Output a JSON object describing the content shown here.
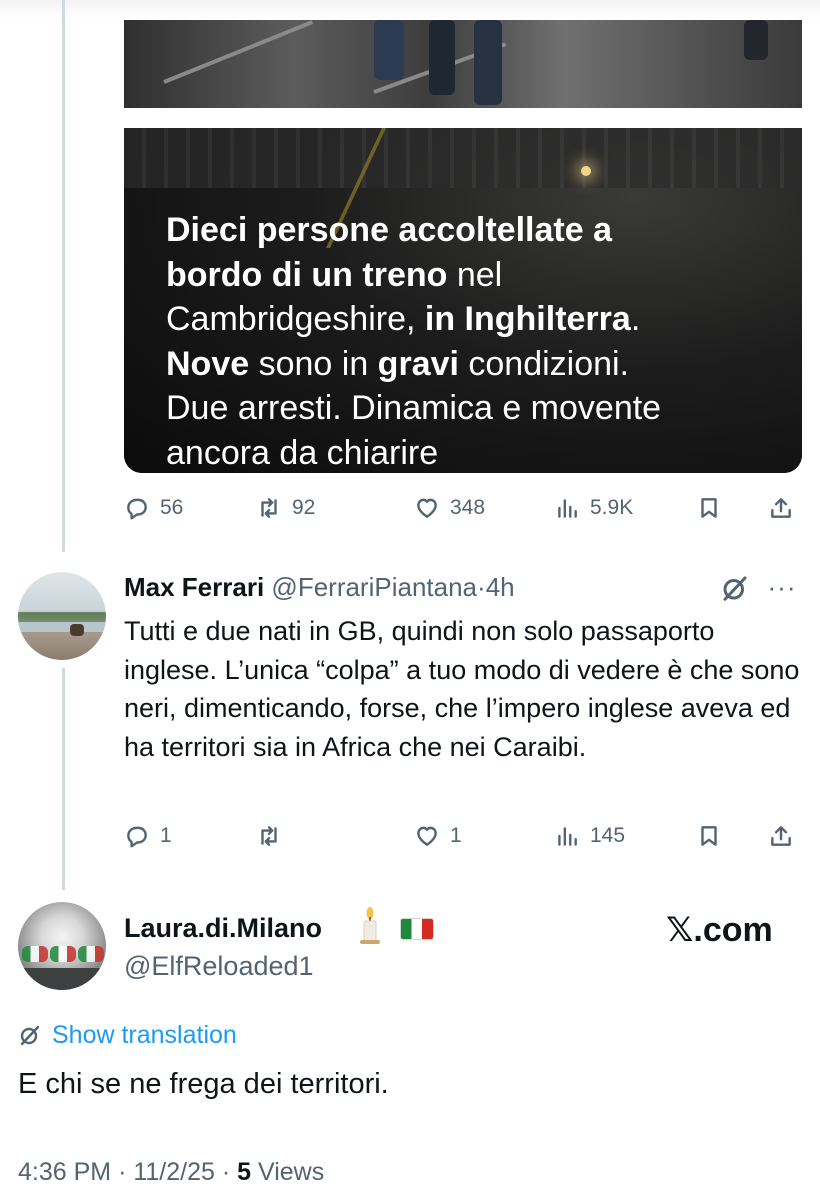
{
  "quoted_tweet": {
    "caption": {
      "line1_bold": "Dieci persone accoltellate a",
      "line2_bold": "bordo di un treno",
      "line2_rest": " nel",
      "line3_a": "Cambridgeshire, ",
      "line3_bold": "in Inghilterra",
      "line3_end": ".",
      "line4_bold_a": "Nove",
      "line4_mid": " sono in ",
      "line4_bold_b": "gravi",
      "line4_end": " condizioni.",
      "line5": "Due arresti. Dinamica e movente",
      "line6": "ancora da chiarire"
    },
    "stats": {
      "replies": "56",
      "reposts": "92",
      "likes": "348",
      "views": "5.9K"
    }
  },
  "reply": {
    "name": "Max Ferrari",
    "handle": "@FerrariPiantana",
    "separator": "·",
    "time": "4h",
    "more_label": "···",
    "text": "Tutti e due nati in GB, quindi non solo passaporto inglese. L’unica “colpa” a tuo modo di vedere è che sono neri, dimenticando, forse, che l’impero inglese aveva ed ha territori sia in Africa che nei Caraibi.",
    "stats": {
      "replies": "1",
      "reposts": "",
      "likes": "1",
      "views": "145"
    }
  },
  "main_tweet": {
    "name": "Laura.di.Milano",
    "handle": "@ElfReloaded1",
    "watermark": "𝕏.com",
    "show_translation": "Show translation",
    "text": "E chi se ne frega dei territori.",
    "time": "4:36 PM",
    "separator": "·",
    "date": "11/2/25",
    "views_count": "5",
    "views_label": "Views"
  },
  "icons": [
    "reply-icon",
    "repost-icon",
    "like-icon",
    "views-icon",
    "bookmark-icon",
    "share-icon",
    "translate-icon",
    "more-icon",
    "candle-emoji",
    "italy-flag-emoji"
  ],
  "colors": {
    "text": "#0f1419",
    "secondary": "#536471",
    "link": "#1d9bf0",
    "thread_line": "#cfd9de"
  }
}
